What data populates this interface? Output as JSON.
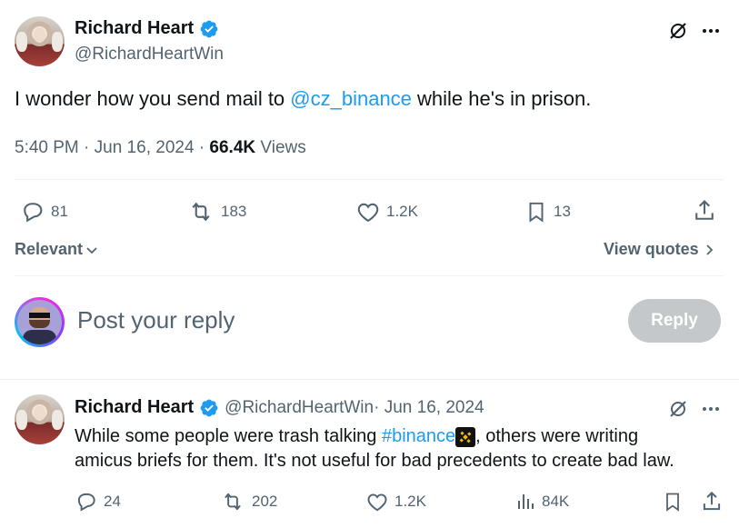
{
  "tweet": {
    "author": {
      "name": "Richard Heart",
      "handle": "@RichardHeartWin"
    },
    "text_before": "I wonder how you send mail to ",
    "mention": "@cz_binance",
    "text_after": " while he's in prison.",
    "time": "5:40 PM · Jun 16, 2024",
    "dot": " · ",
    "views_count": "66.4K",
    "views_label": " Views",
    "stats": {
      "replies": "81",
      "retweets": "183",
      "likes": "1.2K",
      "bookmarks": "13"
    }
  },
  "sort": {
    "label": "Relevant",
    "quotes_link": "View quotes"
  },
  "compose": {
    "placeholder": "Post your reply",
    "button": "Reply"
  },
  "reply": {
    "author": {
      "name": "Richard Heart",
      "handle": "@RichardHeartWin"
    },
    "date": " · Jun 16, 2024",
    "text_before": "While some people were trash talking ",
    "hashtag": "#binance",
    "text_after": ", others were writing",
    "text_line2": "amicus briefs for them. It's not useful for bad precedents to create bad law.",
    "stats": {
      "replies": "24",
      "retweets": "202",
      "likes": "1.2K",
      "views": "84K"
    }
  },
  "colors": {
    "accent": "#1d9bf0",
    "muted": "#536471",
    "text": "#0f1419",
    "reply_disabled": "#c4c8cb"
  },
  "icons": [
    "verified-badge-icon",
    "grok-icon",
    "more-icon",
    "reply-icon",
    "retweet-icon",
    "like-icon",
    "bookmark-icon",
    "share-icon",
    "chevron-down-icon",
    "chevron-right-icon",
    "views-icon",
    "binance-emoji-icon"
  ]
}
